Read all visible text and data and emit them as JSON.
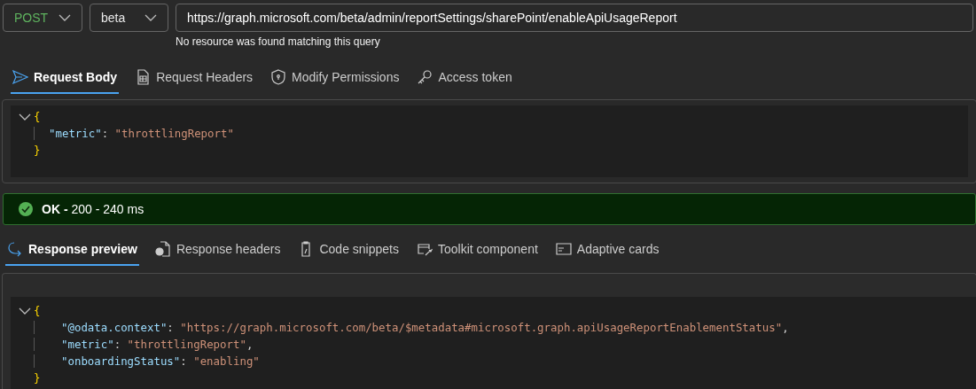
{
  "request": {
    "method": "POST",
    "version": "beta",
    "url": "https://graph.microsoft.com/beta/admin/reportSettings/sharePoint/enableApiUsageReport",
    "message": "No resource was found matching this query"
  },
  "request_tabs": [
    {
      "label": "Request Body",
      "selected": true
    },
    {
      "label": "Request Headers",
      "selected": false
    },
    {
      "label": "Modify Permissions",
      "selected": false
    },
    {
      "label": "Access token",
      "selected": false
    }
  ],
  "request_body": [
    {
      "kind": "open",
      "tokens": [
        {
          "kind": "brace",
          "text": "{"
        }
      ]
    },
    {
      "kind": "member",
      "tokens": [
        {
          "kind": "key",
          "text": "\"metric\""
        },
        {
          "kind": "punct",
          "text": ": "
        },
        {
          "kind": "string",
          "text": "\"throttlingReport\""
        }
      ]
    },
    {
      "kind": "close",
      "tokens": [
        {
          "kind": "brace",
          "text": "}"
        }
      ]
    }
  ],
  "status": {
    "ok": true,
    "label": "OK -",
    "detail": "200 - 240 ms"
  },
  "response_tabs": [
    {
      "label": "Response preview",
      "selected": true
    },
    {
      "label": "Response headers",
      "selected": false
    },
    {
      "label": "Code snippets",
      "selected": false
    },
    {
      "label": "Toolkit component",
      "selected": false
    },
    {
      "label": "Adaptive cards",
      "selected": false
    }
  ],
  "response_body": [
    {
      "kind": "open",
      "tokens": [
        {
          "kind": "brace",
          "text": "{"
        }
      ]
    },
    {
      "kind": "member",
      "tokens": [
        {
          "kind": "key",
          "text": "\"@odata.context\""
        },
        {
          "kind": "punct",
          "text": ": "
        },
        {
          "kind": "string",
          "text": "\"https://graph.microsoft.com/beta/$metadata#microsoft.graph.apiUsageReportEnablementStatus\""
        },
        {
          "kind": "punct",
          "text": ","
        }
      ]
    },
    {
      "kind": "member",
      "tokens": [
        {
          "kind": "key",
          "text": "\"metric\""
        },
        {
          "kind": "punct",
          "text": ": "
        },
        {
          "kind": "string",
          "text": "\"throttlingReport\""
        },
        {
          "kind": "punct",
          "text": ","
        }
      ]
    },
    {
      "kind": "member",
      "tokens": [
        {
          "kind": "key",
          "text": "\"onboardingStatus\""
        },
        {
          "kind": "punct",
          "text": ": "
        },
        {
          "kind": "string",
          "text": "\"enabling\""
        }
      ]
    },
    {
      "kind": "close",
      "tokens": [
        {
          "kind": "brace",
          "text": "}"
        }
      ]
    }
  ]
}
